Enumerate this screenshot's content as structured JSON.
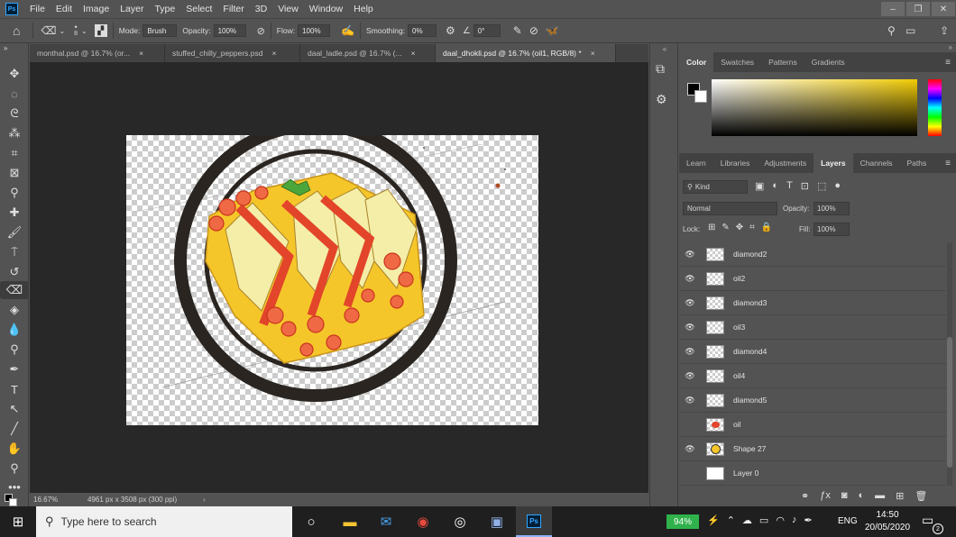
{
  "app": {
    "logo": "Ps"
  },
  "menu": [
    "File",
    "Edit",
    "Image",
    "Layer",
    "Type",
    "Select",
    "Filter",
    "3D",
    "View",
    "Window",
    "Help"
  ],
  "window_controls": {
    "minimize": "–",
    "restore": "❐",
    "close": "✕"
  },
  "options": {
    "brush_size": "8",
    "mode_label": "Mode:",
    "mode_value": "Brush",
    "opacity_label": "Opacity:",
    "opacity_value": "100%",
    "flow_label": "Flow:",
    "flow_value": "100%",
    "smoothing_label": "Smoothing:",
    "smoothing_value": "0%",
    "angle_value": "0°"
  },
  "tabs": [
    {
      "label": "monthal.psd @ 16.7% (or...",
      "close": "×"
    },
    {
      "label": "stuffed_chilly_peppers.psd",
      "close": "×"
    },
    {
      "label": "daal_ladle.psd @ 16.7% (...",
      "close": "×"
    },
    {
      "label": "daal_dhokli.psd @ 16.7% (oil1, RGB/8) *",
      "close": "×"
    }
  ],
  "status": {
    "zoom": "16.67%",
    "doc_info": "4961 px x 3508 px (300 ppi)"
  },
  "color_panel": {
    "tabs": [
      "Color",
      "Swatches",
      "Patterns",
      "Gradients"
    ],
    "active": "Color"
  },
  "layers_panel": {
    "tabs": [
      "Learn",
      "Libraries",
      "Adjustments",
      "Layers",
      "Channels",
      "Paths"
    ],
    "active": "Layers",
    "filter_kind": "Kind",
    "blend_mode": "Normal",
    "opacity_label": "Opacity:",
    "opacity_value": "100%",
    "lock_label": "Lock:",
    "fill_label": "Fill:",
    "fill_value": "100%",
    "layers": [
      {
        "name": "diamond2",
        "visible": true
      },
      {
        "name": "oil2",
        "visible": true
      },
      {
        "name": "diamond3",
        "visible": true
      },
      {
        "name": "oil3",
        "visible": true
      },
      {
        "name": "diamond4",
        "visible": true
      },
      {
        "name": "oil4",
        "visible": true
      },
      {
        "name": "diamond5",
        "visible": true
      },
      {
        "name": "oil",
        "visible": false
      },
      {
        "name": "Shape 27",
        "visible": true
      },
      {
        "name": "Layer 0",
        "visible": false
      }
    ]
  },
  "taskbar": {
    "search_placeholder": "Type here to search",
    "battery": "94%",
    "language": "ENG",
    "time": "14:50",
    "date": "20/05/2020",
    "notification_count": "2"
  },
  "colors": {
    "accent": "#31a8ff",
    "food_yellow": "#f5c62a",
    "food_red": "#e2452a",
    "battery": "#2fb24b"
  }
}
